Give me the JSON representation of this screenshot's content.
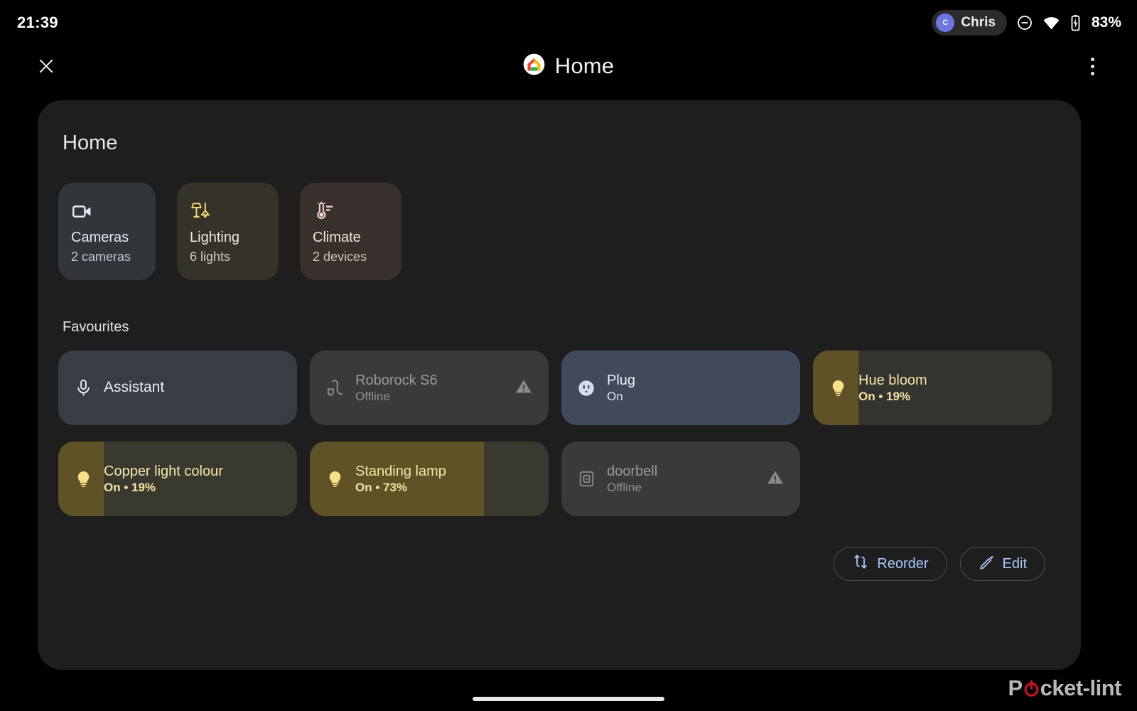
{
  "statusbar": {
    "clock": "21:39",
    "user": {
      "name": "Chris",
      "initial": "C",
      "avatar_color": "#6b76e0"
    },
    "icons": [
      "do-not-disturb-icon",
      "wifi-icon",
      "battery-charging-icon"
    ],
    "battery": "83%"
  },
  "appbar": {
    "close_label": "close-icon",
    "title": "Home",
    "logo": "google-home-logo",
    "overflow_label": "more-options-icon"
  },
  "panel": {
    "title": "Home",
    "categories": [
      {
        "name": "Cameras",
        "sub": "2 cameras",
        "icon": "video-camera-icon",
        "bg": "#32353a",
        "fg": "#e6e9ef",
        "icon_color": "#e6e9ef"
      },
      {
        "name": "Lighting",
        "sub": "6 lights",
        "icon": "lamps-icon",
        "bg": "#35322a",
        "fg": "#efe8dc",
        "icon_color": "#f5d76e"
      },
      {
        "name": "Climate",
        "sub": "2 devices",
        "icon": "thermostat-icon",
        "bg": "#38302c",
        "fg": "#f0e4df",
        "icon_color": "#f6ddd4"
      }
    ],
    "favourites_title": "Favourites",
    "favourites": [
      {
        "name": "Assistant",
        "state": "",
        "icon": "microphone-icon",
        "card_bg": "#383c43",
        "fill_color": "",
        "fill_pct": 0,
        "name_color": "#e9eaee",
        "state_color": "#b9bcc2",
        "icon_color": "#e9eaee",
        "warning": false
      },
      {
        "name": "Roborock S6",
        "state": "Offline",
        "icon": "vacuum-icon",
        "card_bg": "#3a3a3a",
        "fill_color": "",
        "fill_pct": 0,
        "name_color": "#9a9a9a",
        "state_color": "#8f8f8f",
        "icon_color": "#8b8b8b",
        "warning": true
      },
      {
        "name": "Plug",
        "state": "On",
        "icon": "power-outlet-icon",
        "card_bg": "#414a5d",
        "fill_color": "",
        "fill_pct": 0,
        "name_color": "#eceff5",
        "state_color": "#dfe3ea",
        "icon_color": "#d7dde8",
        "warning": false
      },
      {
        "name": "Hue bloom",
        "state": "On • 19%",
        "icon": "lightbulb-icon",
        "card_bg": "#333330",
        "fill_color": "#5e5226",
        "fill_pct": 19,
        "name_color": "#f6e6a6",
        "state_color": "#f3e3a2",
        "icon_color": "#f7e08a",
        "warning": false
      },
      {
        "name": "Copper light colour",
        "state": "On • 19%",
        "icon": "lightbulb-icon",
        "card_bg": "#3a3930",
        "fill_color": "#5e5226",
        "fill_pct": 19,
        "name_color": "#f6e6a6",
        "state_color": "#f3e3a2",
        "icon_color": "#f7e08a",
        "warning": false
      },
      {
        "name": "Standing lamp",
        "state": "On • 73%",
        "icon": "lightbulb-icon",
        "card_bg": "#3a3930",
        "fill_color": "#5e5226",
        "fill_pct": 73,
        "name_color": "#f6e6a6",
        "state_color": "#f3e3a2",
        "icon_color": "#f7e08a",
        "warning": false
      },
      {
        "name": "doorbell",
        "state": "Offline",
        "icon": "doorbell-icon",
        "card_bg": "#3a3a3a",
        "fill_color": "",
        "fill_pct": 0,
        "name_color": "#9a9a9a",
        "state_color": "#8f8f8f",
        "icon_color": "#8b8b8b",
        "warning": true
      }
    ],
    "actions": [
      {
        "label": "Reorder",
        "icon": "reorder-arrows-icon"
      },
      {
        "label": "Edit",
        "icon": "pencil-icon"
      }
    ]
  },
  "watermark": {
    "part1": "P",
    "part2": "cket-lint",
    "power_color": "#c0132a"
  },
  "theme": {
    "accent_blue": "#a8c7fa",
    "panel_bg": "#1e1e1e",
    "page_bg": "#000000"
  }
}
